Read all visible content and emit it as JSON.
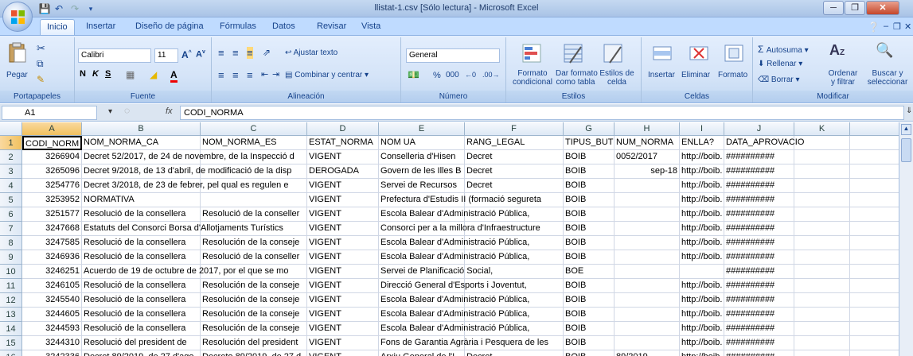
{
  "window": {
    "title": "llistat-1.csv  [Sólo lectura] - Microsoft Excel"
  },
  "tabs": [
    "Inicio",
    "Insertar",
    "Diseño de página",
    "Fórmulas",
    "Datos",
    "Revisar",
    "Vista"
  ],
  "ribbon": {
    "paste": "Pegar",
    "clipboard": "Portapapeles",
    "font_name": "Calibri",
    "font_size": "11",
    "font": "Fuente",
    "wrap": "Ajustar texto",
    "merge": "Combinar y centrar",
    "alignment": "Alineación",
    "number_format": "General",
    "percent": "%",
    "thousands": "000",
    "number": "Número",
    "cond_format": "Formato",
    "cond_format2": "condicional",
    "table_format": "Dar formato",
    "table_format2": "como tabla",
    "cell_styles": "Estilos de",
    "cell_styles2": "celda",
    "styles": "Estilos",
    "insert": "Insertar",
    "delete": "Eliminar",
    "format": "Formato",
    "cells": "Celdas",
    "autosum": "Autosuma",
    "fill": "Rellenar",
    "clear": "Borrar",
    "sort": "Ordenar",
    "sort2": "y filtrar",
    "find": "Buscar y",
    "find2": "seleccionar",
    "modify": "Modificar"
  },
  "formula_bar": {
    "name_box": "A1",
    "fx": "fx",
    "content": "CODI_NORMA"
  },
  "columns": [
    "A",
    "B",
    "C",
    "D",
    "E",
    "F",
    "G",
    "H",
    "I",
    "J",
    "K"
  ],
  "rows": [
    {
      "n": "1",
      "a": "CODI_NORM",
      "b": "NOM_NORMA_CA",
      "c": "NOM_NORMA_ES",
      "d": "ESTAT_NORMA",
      "e": "NOM UA",
      "f": "RANG_LEGAL",
      "g": "TIPUS_BUTLL",
      "h": "NUM_NORMA",
      "i": "ENLLA?",
      "j": "DATA_APROVACIO",
      "k": ""
    },
    {
      "n": "2",
      "a": "3266904",
      "b": "Decret 52/2017, de 24 de novembre, de la Inspecció d",
      "c": "",
      "d": "VIGENT",
      "e": "Conselleria d'Hisen",
      "f": "Decret",
      "g": "BOIB",
      "h": "0052/2017",
      "i": "http://boib.",
      "j": "##########",
      "k": ""
    },
    {
      "n": "3",
      "a": "3265096",
      "b": "Decret 9/2018, de 13 d'abril, de modificació de la disp",
      "c": "",
      "d": "DEROGADA",
      "e": "Govern de les Illes B",
      "f": "Decret",
      "g": "BOIB",
      "h": "sep-18",
      "i": "http://boib.",
      "j": "##########",
      "k": ""
    },
    {
      "n": "4",
      "a": "3254776",
      "b": "Decret 3/2018, de 23 de febrer, pel qual es regulen e",
      "c": "",
      "d": "VIGENT",
      "e": "Servei de Recursos",
      "f": "Decret",
      "g": "BOIB",
      "h": "",
      "i": "http://boib.",
      "j": "##########",
      "k": ""
    },
    {
      "n": "5",
      "a": "3253952",
      "b": "NORMATIVA",
      "c": "",
      "d": "VIGENT",
      "e": "Prefectura d'Estudis II (formació segureta",
      "f": "",
      "g": "BOIB",
      "h": "",
      "i": "http://boib.",
      "j": "##########",
      "k": ""
    },
    {
      "n": "6",
      "a": "3251577",
      "b": "Resolució de la consellera",
      "c": "Resolució de la conseller",
      "d": "VIGENT",
      "e": "Escola Balear d'Administració Pública,",
      "f": "",
      "g": "BOIB",
      "h": "",
      "i": "http://boib.",
      "j": "##########",
      "k": ""
    },
    {
      "n": "7",
      "a": "3247668",
      "b": "Estatuts del Consorci Borsa d'Allotjaments Turístics",
      "c": "",
      "d": "VIGENT",
      "e": "Consorci per a la millora d'Infraestructure",
      "f": "",
      "g": "BOIB",
      "h": "",
      "i": "http://boib.",
      "j": "##########",
      "k": ""
    },
    {
      "n": "8",
      "a": "3247585",
      "b": "Resolució de la consellera",
      "c": "Resolución de la conseje",
      "d": "VIGENT",
      "e": "Escola Balear d'Administració Pública,",
      "f": "",
      "g": "BOIB",
      "h": "",
      "i": "http://boib.",
      "j": "##########",
      "k": ""
    },
    {
      "n": "9",
      "a": "3246936",
      "b": "Resolució de la consellera",
      "c": "Resolució de la conseller",
      "d": "VIGENT",
      "e": "Escola Balear d'Administració Pública,",
      "f": "",
      "g": "BOIB",
      "h": "",
      "i": "http://boib.",
      "j": "##########",
      "k": ""
    },
    {
      "n": "10",
      "a": "3246251",
      "b": "Acuerdo de 19 de octubre de 2017, por el que se mo",
      "c": "",
      "d": "VIGENT",
      "e": "Servei de Planificació Social,",
      "f": "",
      "g": "BOE",
      "h": "",
      "i": "",
      "j": "##########",
      "k": ""
    },
    {
      "n": "11",
      "a": "3246105",
      "b": "Resolució de la consellera",
      "c": "Resolución de la conseje",
      "d": "VIGENT",
      "e": "Direcció General d'Esports i Joventut,",
      "f": "",
      "g": "BOIB",
      "h": "",
      "i": "http://boib.",
      "j": "##########",
      "k": ""
    },
    {
      "n": "12",
      "a": "3245540",
      "b": "Resolució de la consellera",
      "c": "Resolución de la conseje",
      "d": "VIGENT",
      "e": "Escola Balear d'Administració Pública,",
      "f": "",
      "g": "BOIB",
      "h": "",
      "i": "http://boib.",
      "j": "##########",
      "k": ""
    },
    {
      "n": "13",
      "a": "3244605",
      "b": "Resolució de la consellera",
      "c": "Resolución de la conseje",
      "d": "VIGENT",
      "e": "Escola Balear d'Administració Pública,",
      "f": "",
      "g": "BOIB",
      "h": "",
      "i": "http://boib.",
      "j": "##########",
      "k": ""
    },
    {
      "n": "14",
      "a": "3244593",
      "b": "Resolució de la consellera",
      "c": "Resolución  de la conseje",
      "d": "VIGENT",
      "e": "Escola Balear d'Administració Pública,",
      "f": "",
      "g": "BOIB",
      "h": "",
      "i": "http://boib.",
      "j": "##########",
      "k": ""
    },
    {
      "n": "15",
      "a": "3244310",
      "b": "Resolució del president de",
      "c": "Resolución del president",
      "d": "VIGENT",
      "e": "Fons de Garantia Agrària i Pesquera de les",
      "f": "",
      "g": "BOIB",
      "h": "",
      "i": "http://boib.",
      "j": "##########",
      "k": ""
    },
    {
      "n": "16",
      "a": "3242336",
      "b": "Decret 89/2019, de 27 d'ago",
      "c": "Decreto 89/2019, de 27 d",
      "d": "VIGENT",
      "e": "Arxiu General de l'I",
      "f": "Decret",
      "g": "BOIB",
      "h": "89/2019",
      "i": "http://boib.",
      "j": "##########",
      "k": ""
    }
  ]
}
